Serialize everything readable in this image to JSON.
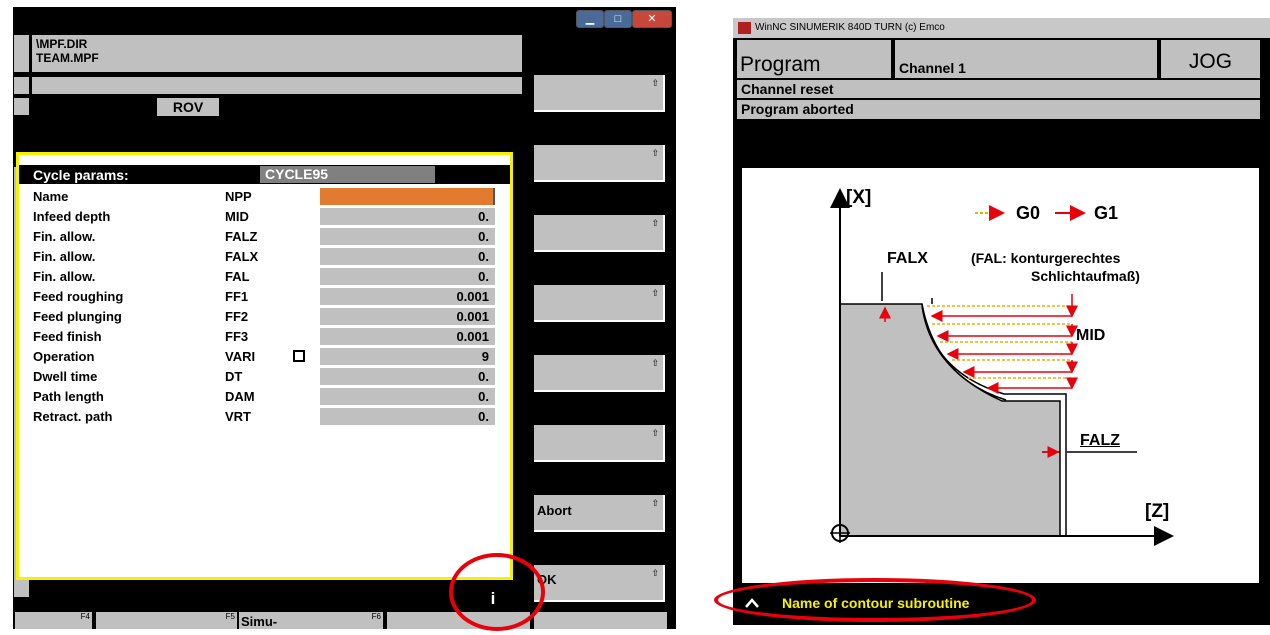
{
  "left": {
    "path": [
      "\\MPF.DIR",
      "TEAM.MPF"
    ],
    "rov_label": "ROV",
    "dialog": {
      "title_label": "Cycle params:",
      "title_value": "CYCLE95",
      "params": [
        {
          "name": "Name",
          "code": "NPP",
          "value": ""
        },
        {
          "name": "Infeed depth",
          "code": "MID",
          "value": "0."
        },
        {
          "name": "Fin. allow.",
          "code": "FALZ",
          "value": "0."
        },
        {
          "name": "Fin. allow.",
          "code": "FALX",
          "value": "0."
        },
        {
          "name": "Fin. allow.",
          "code": "FAL",
          "value": "0."
        },
        {
          "name": "Feed roughing",
          "code": "FF1",
          "value": "0.001"
        },
        {
          "name": "Feed plunging",
          "code": "FF2",
          "value": "0.001"
        },
        {
          "name": "Feed finish",
          "code": "FF3",
          "value": "0.001"
        },
        {
          "name": "Operation",
          "code": "VARI",
          "value": "9"
        },
        {
          "name": "Dwell time",
          "code": "DT",
          "value": "0."
        },
        {
          "name": "Path length",
          "code": "DAM",
          "value": "0."
        },
        {
          "name": "Retract. path",
          "code": "VRT",
          "value": "0."
        }
      ]
    },
    "info_label": "i",
    "softkeys": {
      "abort": "Abort",
      "ok": "OK"
    },
    "fkeys": {
      "f4": "F4",
      "f5": "F5",
      "f5_label": "Simu-",
      "f6": "F6"
    },
    "colors": {
      "dialog_border": "#f5f100",
      "active_field": "#e07b2f",
      "highlight_ellipse": "#e8000b"
    }
  },
  "right": {
    "window_title": "WinNC SINUMERIK 840D TURN (c) Emco",
    "area": "Program",
    "channel": "Channel 1",
    "mode": "JOG",
    "status1": "Channel reset",
    "status2": "Program aborted",
    "diagram": {
      "axis_x": "[X]",
      "axis_z": "[Z]",
      "g0": "G0",
      "g1": "G1",
      "falx": "FALX",
      "fal_note1": "(FAL: konturgerechtes",
      "fal_note2": "Schlichtaufmaß)",
      "mid": "MID",
      "falz": "FALZ"
    },
    "hint": "Name of contour subroutine"
  }
}
